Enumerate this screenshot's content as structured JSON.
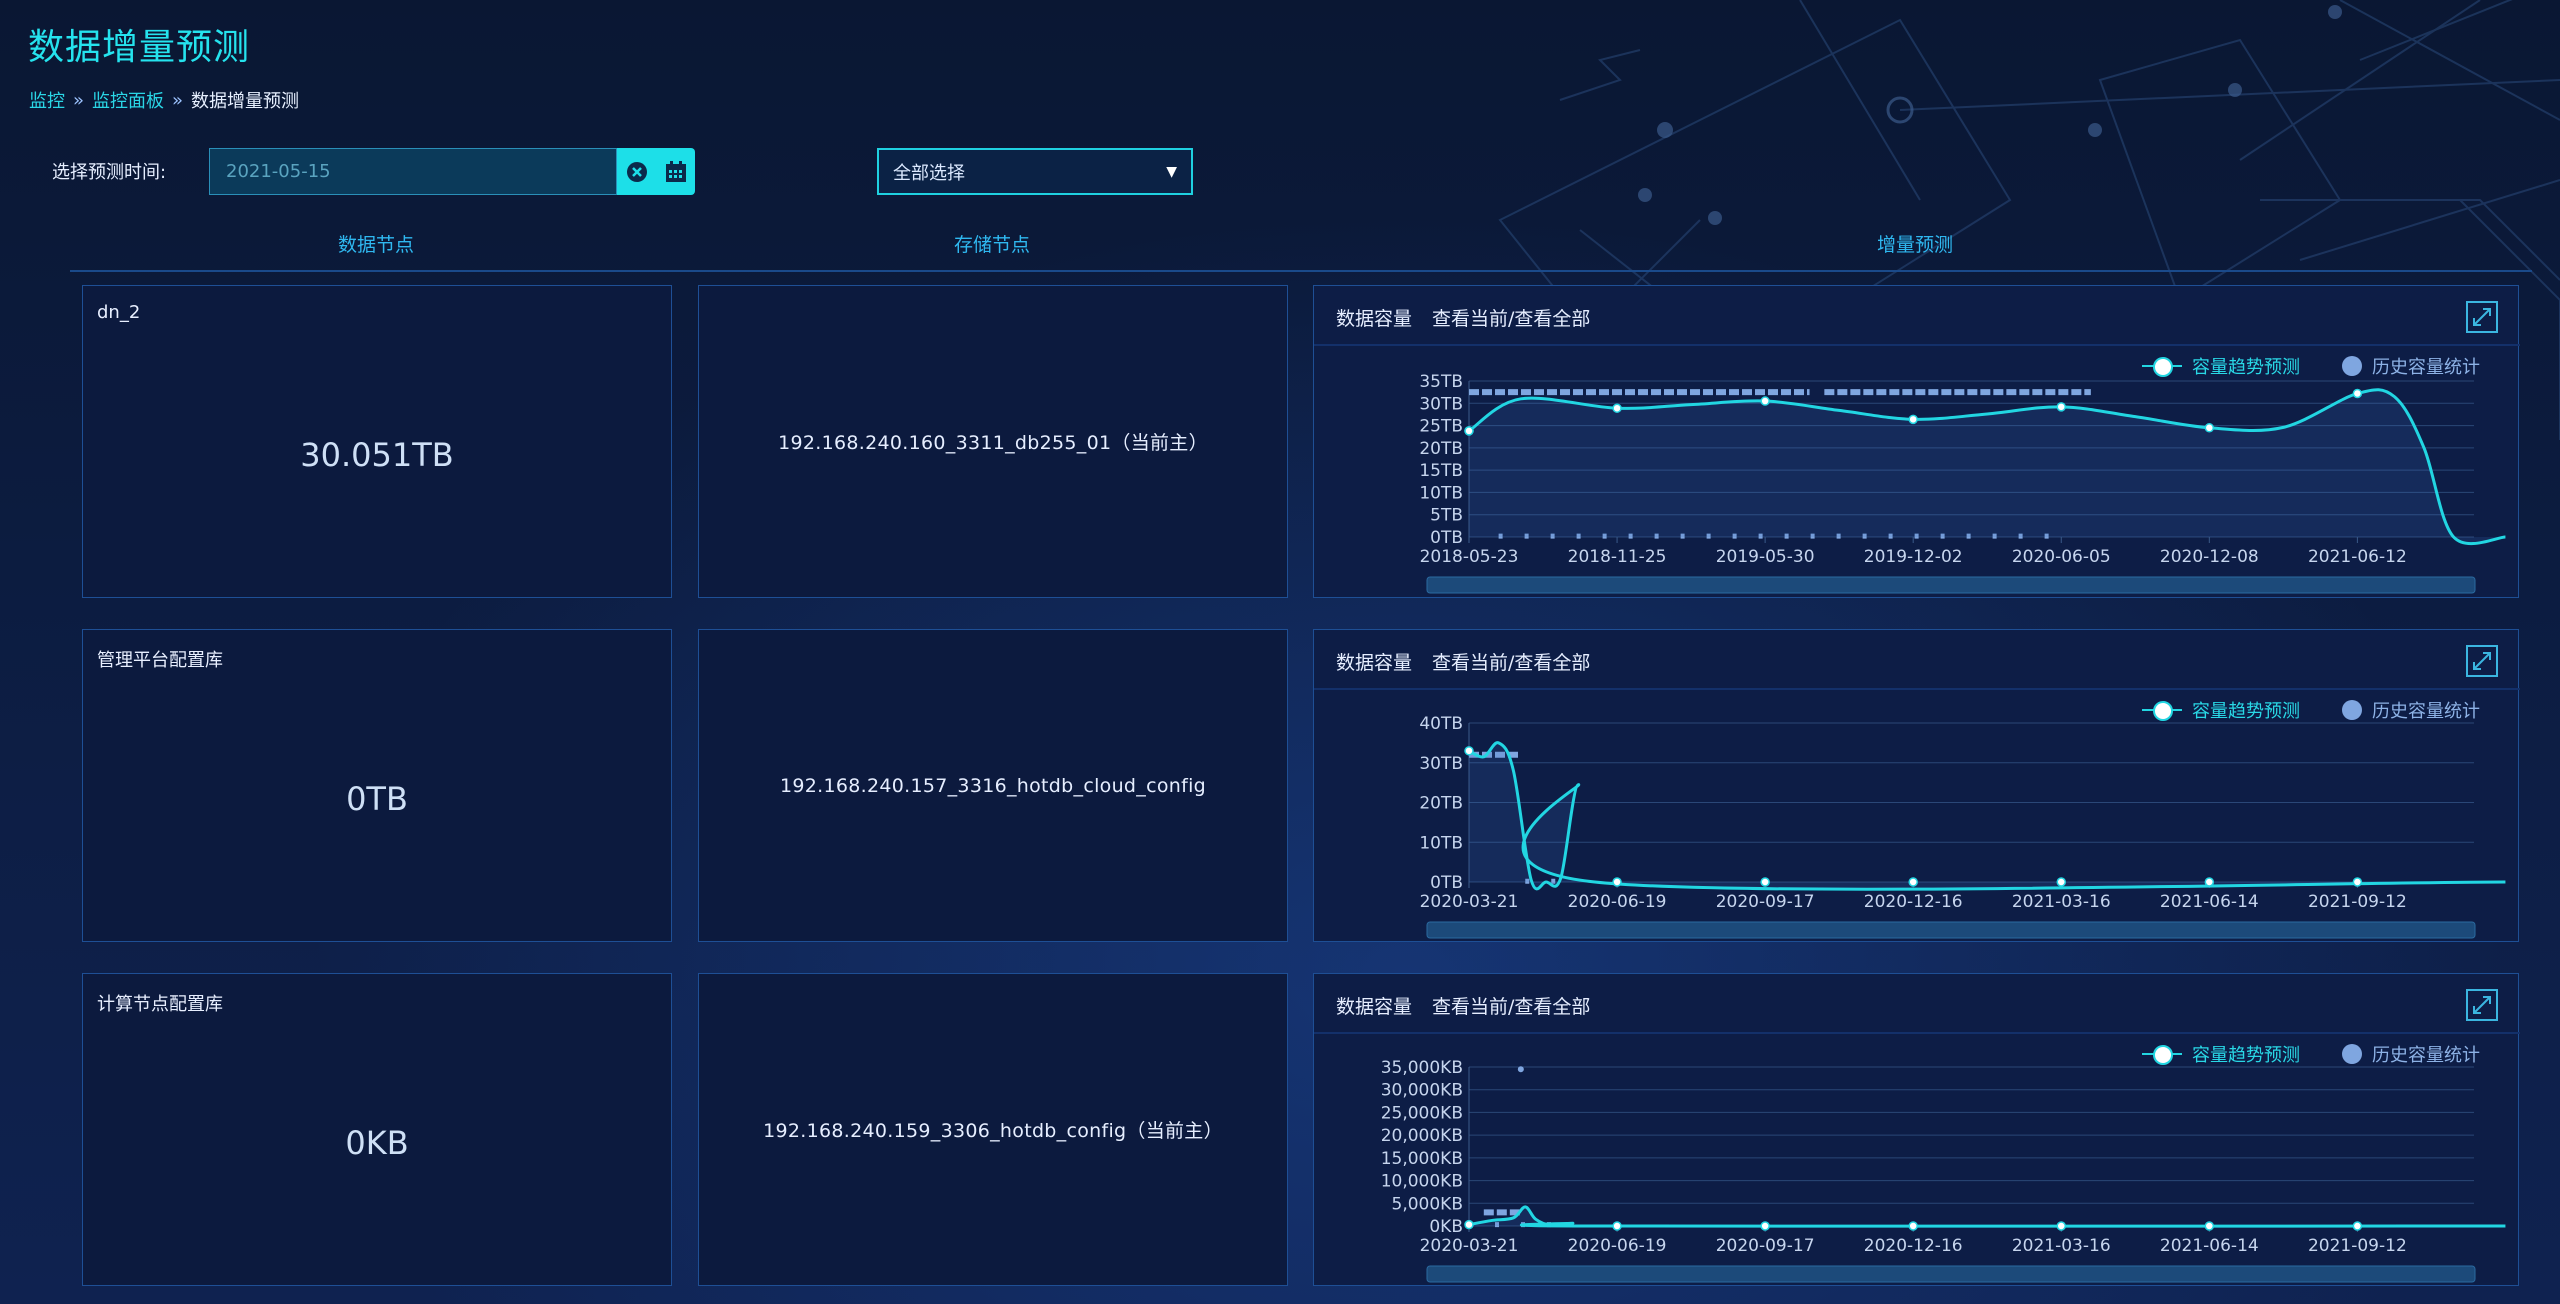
{
  "page": {
    "title": "数据增量预测"
  },
  "breadcrumb": {
    "items": [
      "监控",
      "监控面板",
      "数据增量预测"
    ]
  },
  "filter": {
    "label": "选择预测时间:",
    "date_value": "2021-05-15",
    "select_value": "全部选择"
  },
  "columns": [
    "数据节点",
    "存储节点",
    "增量预测"
  ],
  "chart_header": {
    "title": "数据容量",
    "toggle": "查看当前/查看全部"
  },
  "legend": {
    "trend": "容量趋势预测",
    "history": "历史容量统计"
  },
  "colors": {
    "accent": "#22d6e2",
    "history": "#7fa6e0",
    "title": "#25e3ee"
  },
  "rows": [
    {
      "data_node": {
        "name": "dn_2",
        "value": "30.051TB"
      },
      "storage_node": "192.168.240.160_3311_db255_01（当前主）",
      "chart_data": {
        "type": "line",
        "x_ticks": [
          "2018-05-23",
          "2018-11-25",
          "2019-05-30",
          "2019-12-02",
          "2020-06-05",
          "2020-12-08",
          "2021-06-12"
        ],
        "y_ticks": [
          "0TB",
          "5TB",
          "10TB",
          "15TB",
          "20TB",
          "25TB",
          "30TB",
          "35TB"
        ],
        "ylim": [
          0,
          35
        ],
        "trend": [
          {
            "x": 0.0,
            "y": 23.8
          },
          {
            "x": 0.35,
            "y": 31.0
          },
          {
            "x": 1.0,
            "y": 28.9
          },
          {
            "x": 1.5,
            "y": 29.7
          },
          {
            "x": 2.0,
            "y": 30.5
          },
          {
            "x": 2.5,
            "y": 28.4
          },
          {
            "x": 3.0,
            "y": 26.4
          },
          {
            "x": 3.5,
            "y": 27.6
          },
          {
            "x": 4.0,
            "y": 29.2
          },
          {
            "x": 4.5,
            "y": 27.0
          },
          {
            "x": 5.0,
            "y": 24.5
          },
          {
            "x": 5.5,
            "y": 24.6
          },
          {
            "x": 6.0,
            "y": 32.2
          },
          {
            "x": 6.25,
            "y": 31.5
          },
          {
            "x": 6.45,
            "y": 20.0
          },
          {
            "x": 6.65,
            "y": 0.0
          },
          {
            "x": 7.0,
            "y": 0.0
          }
        ],
        "trend_markers": [
          0,
          1,
          2,
          3,
          4,
          5,
          6
        ],
        "history_high": {
          "y": 32.5,
          "ranges": [
            [
              0.0,
              2.3
            ],
            [
              2.4,
              4.2
            ]
          ]
        },
        "history_low": {
          "y": 0.2,
          "ranges": [
            [
              0.2,
              4.0
            ]
          ]
        }
      }
    },
    {
      "data_node": {
        "name": "管理平台配置库",
        "value": "0TB"
      },
      "storage_node": "192.168.240.157_3316_hotdb_cloud_config",
      "chart_data": {
        "type": "line",
        "x_ticks": [
          "2020-03-21",
          "2020-06-19",
          "2020-09-17",
          "2020-12-16",
          "2021-03-16",
          "2021-06-14",
          "2021-09-12"
        ],
        "y_ticks": [
          "0TB",
          "10TB",
          "20TB",
          "30TB",
          "40TB"
        ],
        "ylim": [
          0,
          40
        ],
        "trend": [
          {
            "x": 0.0,
            "y": 33.0
          },
          {
            "x": 0.1,
            "y": 31.5
          },
          {
            "x": 0.2,
            "y": 35.0
          },
          {
            "x": 0.3,
            "y": 28.0
          },
          {
            "x": 0.42,
            "y": 0.5
          },
          {
            "x": 0.52,
            "y": 0.0
          },
          {
            "x": 0.62,
            "y": 1.0
          },
          {
            "x": 0.74,
            "y": 24.5
          },
          {
            "x": 0.85,
            "y": 0.0
          },
          {
            "x": 7.0,
            "y": 0.0
          }
        ],
        "trend_markers": [
          1,
          2,
          3,
          4,
          5,
          6
        ],
        "history_high": {
          "y": 32.0,
          "ranges": [
            [
              0.0,
              0.35
            ]
          ]
        },
        "history_low": {
          "y": 0.2,
          "ranges": [
            [
              0.38,
              0.62
            ]
          ]
        }
      }
    },
    {
      "data_node": {
        "name": "计算节点配置库",
        "value": "0KB"
      },
      "storage_node": "192.168.240.159_3306_hotdb_config（当前主）",
      "chart_data": {
        "type": "line",
        "x_ticks": [
          "2020-03-21",
          "2020-06-19",
          "2020-09-17",
          "2020-12-16",
          "2021-03-16",
          "2021-06-14",
          "2021-09-12"
        ],
        "y_ticks": [
          "0KB",
          "5,000KB",
          "10,000KB",
          "15,000KB",
          "20,000KB",
          "25,000KB",
          "30,000KB",
          "35,000KB"
        ],
        "ylim": [
          0,
          35000
        ],
        "trend": [
          {
            "x": 0.0,
            "y": 300
          },
          {
            "x": 0.15,
            "y": 1200
          },
          {
            "x": 0.3,
            "y": 1800
          },
          {
            "x": 0.38,
            "y": 4200
          },
          {
            "x": 0.45,
            "y": 1500
          },
          {
            "x": 0.55,
            "y": 200
          },
          {
            "x": 0.7,
            "y": 600
          },
          {
            "x": 0.85,
            "y": 0
          },
          {
            "x": 7.0,
            "y": 0
          }
        ],
        "trend_markers": [
          1,
          2,
          3,
          4,
          5,
          6
        ],
        "history_high": {
          "y": 3000,
          "ranges": [
            [
              0.1,
              0.35
            ]
          ]
        },
        "history_low": {
          "y": 300,
          "ranges": [
            [
              0.0,
              0.6
            ]
          ]
        },
        "history_outlier": {
          "x": 0.35,
          "y": 34500
        }
      }
    }
  ]
}
